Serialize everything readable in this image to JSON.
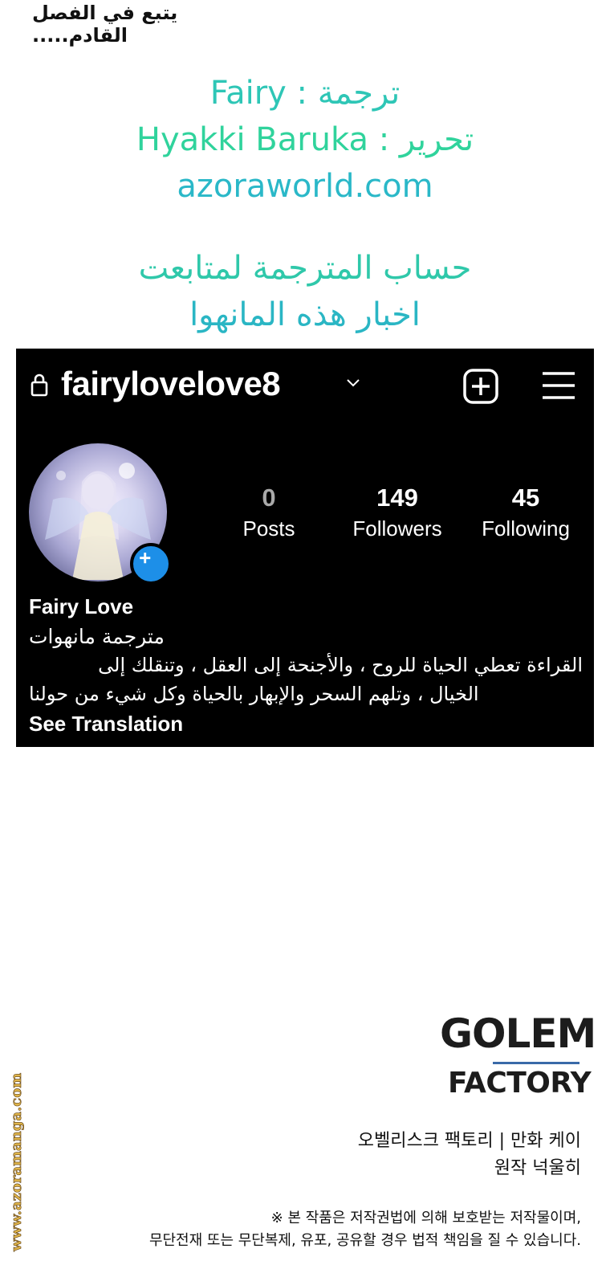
{
  "top_note": "يتبع في الفصل القادم.....",
  "credits": {
    "translation": "Fairy : ترجمة",
    "editing": "Hyakki Baruka : تحرير",
    "site": "azoraworld.com",
    "follow_line1": "حساب المترجمة لمتابعت",
    "follow_line2": "اخبار هذه المانهوا"
  },
  "instagram": {
    "username": "fairylovelove8",
    "stats": [
      {
        "value": "0",
        "label": "Posts"
      },
      {
        "value": "149",
        "label": "Followers"
      },
      {
        "value": "45",
        "label": "Following"
      }
    ],
    "display_name": "Fairy Love",
    "bio_line1": "مترجمة مانهوات",
    "bio_line2": "القراءة تعطي الحياة للروح ، والأجنحة إلى العقل ، وتنقلك إلى",
    "bio_line3": "الخيال ، وتلهم السحر والإبهار بالحياة وكل شيء من حولنا",
    "see_translation": "See Translation"
  },
  "publisher": {
    "logo_line1": "GOLEM",
    "logo_line2": "FACTORY",
    "korean_line1": "오벨리스크 팩토리 | 만화 케이",
    "korean_line2": "원작 넉울히",
    "korean_line3": "※ 본 작품은 저작권법에 의해 보호받는 저작물이며,",
    "korean_line4": "무단전재 또는 무단복제, 유포, 공유할 경우 법적 책임을 질 수 있습니다."
  },
  "watermark": "www.azoramanga.com",
  "colors": {
    "ig_background": "#000000",
    "badge_blue": "#1d8fe8",
    "credit_teal": "#2ec6b6",
    "credit_green": "#30d39c"
  }
}
